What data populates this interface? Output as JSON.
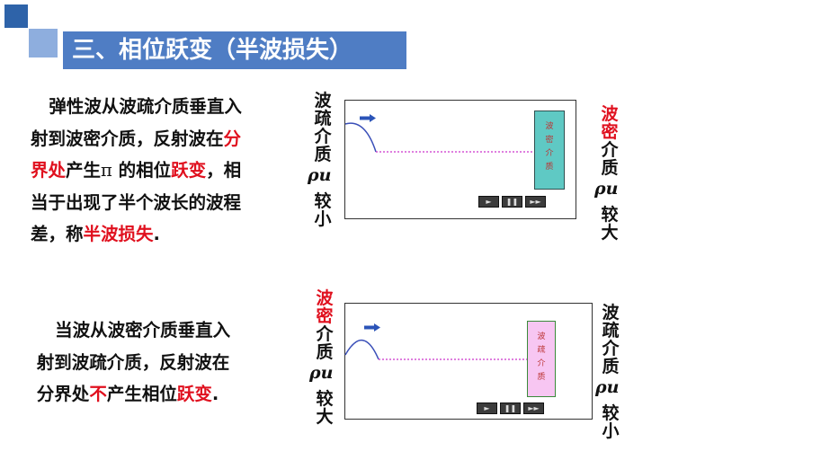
{
  "slide": {
    "title": "三、相位跃变（半波损失）"
  },
  "para1": {
    "line1": "弹性波从波疏介质垂直入",
    "line2": "射到波密介质，反射波在",
    "line2_red": "分",
    "line3_red1": "界处",
    "line3_a": "产生",
    "line3_pi": "π",
    "line3_b": " 的相位",
    "line3_red2": "跃变",
    "line3_c": "，相",
    "line4": "当于出现了半个波长的波程",
    "line5_a": "差，称",
    "line5_red": "半波损失",
    "line5_b": "."
  },
  "para2": {
    "line1": "当波从波密介质垂直入",
    "line2": "射到波疏介质，反射波在",
    "line3_a": "分界处",
    "line3_red1": "不",
    "line3_b": "产生相位",
    "line3_red2": "跃变",
    "line3_c": "."
  },
  "labels": {
    "sparse_top": [
      "波",
      "疏",
      "介",
      "质"
    ],
    "dense_top": [
      "波",
      "密",
      "介",
      "质"
    ],
    "rho_u": "ρu",
    "small": [
      "较",
      "小"
    ],
    "large": [
      "较",
      "大"
    ]
  },
  "media": {
    "dense_text": [
      "波",
      "密",
      "介",
      "质"
    ],
    "sparse_text": [
      "波",
      "疏",
      "介",
      "质"
    ]
  },
  "controls": {
    "play": "►",
    "pause": "❚❚",
    "forward": "►►"
  },
  "colors": {
    "title_bg": "#4f7dc4",
    "accent_red": "#e0101e",
    "dense_medium": "#5fc9c4",
    "sparse_medium": "#f7c6f2",
    "wave_line": "#3a4fb8",
    "dotted_line": "#cc33cc",
    "arrow": "#2b54b8"
  },
  "icons": {
    "arrow": "right-arrow-icon"
  }
}
